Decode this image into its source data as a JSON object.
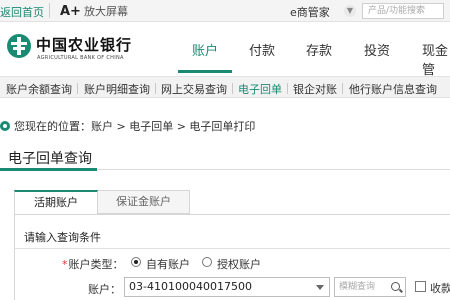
{
  "topbar": {
    "home_link": "返回首页",
    "big_screen_prefix": "A+",
    "big_screen": "放大屏幕",
    "emanager": "e商管家",
    "search_placeholder": "产品/功能搜索"
  },
  "header": {
    "logo_cn": "中国农业银行",
    "logo_en": "AGRICULTURAL BANK OF CHINA",
    "brand_color": "#1a8a73",
    "nav": [
      "账户",
      "付款",
      "存款",
      "投资",
      "现金管"
    ],
    "active_nav": "账户"
  },
  "subnav": {
    "items": [
      "账户余额查询",
      "账户明细查询",
      "网上交易查询",
      "电子回单",
      "银企对账",
      "他行账户信息查询"
    ],
    "active": "电子回单"
  },
  "breadcrumb": "您现在的位置：账户 > 电子回单 > 电子回单打印",
  "page_title": "电子回单查询",
  "tabs": [
    "活期账户",
    "保证金账户"
  ],
  "panel": {
    "title": "请输入查询条件",
    "account_type_label": "账户类型：",
    "account_type_options": [
      "自有账户",
      "授权账户"
    ],
    "account_type_selected": "自有账户",
    "account_label": "账户：",
    "account_value": "03-410100040017500",
    "fuzzy_placeholder": "模糊查询",
    "checkbox_label": "收款"
  }
}
